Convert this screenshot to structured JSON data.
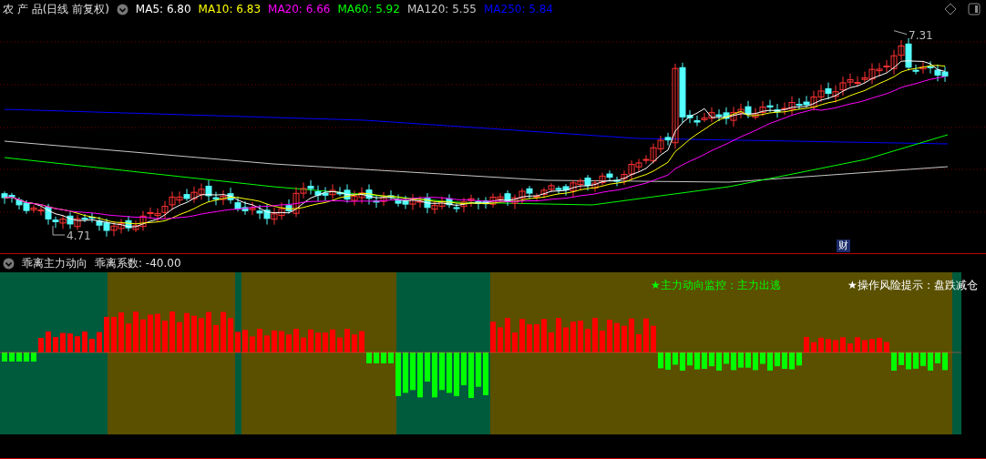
{
  "chart_header": {
    "title": "农 产 品(日线 前复权)",
    "averages": [
      {
        "label": "MA5:",
        "value": "6.80",
        "color": "#ffffff"
      },
      {
        "label": "MA10:",
        "value": "6.83",
        "color": "#ffff00"
      },
      {
        "label": "MA20:",
        "value": "6.66",
        "color": "#ff00ff"
      },
      {
        "label": "MA60:",
        "value": "5.92",
        "color": "#00ff00"
      },
      {
        "label": "MA120:",
        "value": "5.55",
        "color": "#c8c8c8"
      },
      {
        "label": "MA250:",
        "value": "5.84",
        "color": "#0000ff"
      }
    ]
  },
  "price_chart": {
    "high_label": "7.31",
    "low_label": "4.71",
    "event_badge": "财"
  },
  "indicator_header": {
    "title": "乖离主力动向",
    "coefficient": "乖离系数: -40.00"
  },
  "signals": [
    {
      "text": "★主力动向监控：主力出逃",
      "color": "#00ff00"
    },
    {
      "text": "★操作风险提示：盘跌减仓",
      "color": "#ffffff"
    }
  ]
}
